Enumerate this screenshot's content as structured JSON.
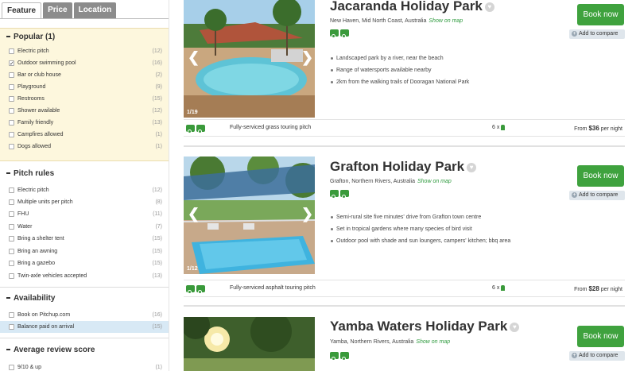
{
  "tabs": [
    "Feature",
    "Price",
    "Location"
  ],
  "sidebar": {
    "popular": {
      "title": "Popular (1)",
      "items": [
        {
          "label": "Electric pitch",
          "count": "(12)",
          "checked": false
        },
        {
          "label": "Outdoor swimming pool",
          "count": "(16)",
          "checked": true
        },
        {
          "label": "Bar or club house",
          "count": "(2)",
          "checked": false
        },
        {
          "label": "Playground",
          "count": "(9)",
          "checked": false
        },
        {
          "label": "Restrooms",
          "count": "(15)",
          "checked": false
        },
        {
          "label": "Shower available",
          "count": "(12)",
          "checked": false
        },
        {
          "label": "Family friendly",
          "count": "(13)",
          "checked": false
        },
        {
          "label": "Campfires allowed",
          "count": "(1)",
          "checked": false
        },
        {
          "label": "Dogs allowed",
          "count": "(1)",
          "checked": false
        }
      ]
    },
    "pitch_rules": {
      "title": "Pitch rules",
      "items": [
        {
          "label": "Electric pitch",
          "count": "(12)"
        },
        {
          "label": "Multiple units per pitch",
          "count": "(8)"
        },
        {
          "label": "FHU",
          "count": "(11)"
        },
        {
          "label": "Water",
          "count": "(7)"
        },
        {
          "label": "Bring a shelter tent",
          "count": "(15)"
        },
        {
          "label": "Bring an awning",
          "count": "(15)"
        },
        {
          "label": "Bring a gazebo",
          "count": "(15)"
        },
        {
          "label": "Twin-axle vehicles accepted",
          "count": "(13)"
        }
      ]
    },
    "availability": {
      "title": "Availability",
      "items": [
        {
          "label": "Book on Pitchup.com",
          "count": "(16)"
        },
        {
          "label": "Balance paid on arrival",
          "count": "(15)"
        }
      ]
    },
    "review": {
      "title": "Average review score",
      "items": [
        {
          "label": "9/10 & up",
          "count": "(1)"
        }
      ]
    }
  },
  "listings": [
    {
      "name": "Jacaranda Holiday Park",
      "location": "New Haven, Mid North Coast, Australia",
      "map_link": "Show on map",
      "photo_count": "1/19",
      "bullets": [
        "Landscaped park by a river, near the beach",
        "Range of watersports available nearby",
        "2km from the walking trails of Dooragan National Park"
      ],
      "book_label": "Book now",
      "compare_label": "Add to compare",
      "pitch_name": "Fully-serviced grass touring pitch",
      "occupancy": "6 x",
      "price_prefix": "From",
      "price": "$36",
      "price_suffix": "per night"
    },
    {
      "name": "Grafton Holiday Park",
      "location": "Grafton, Northern Rivers, Australia",
      "map_link": "Show on map",
      "photo_count": "1/12",
      "bullets": [
        "Semi-rural site five minutes' drive from Grafton town centre",
        "Set in tropical gardens where many species of bird visit",
        "Outdoor pool with shade and sun loungers, campers' kitchen; bbq area"
      ],
      "book_label": "Book now",
      "compare_label": "Add to compare",
      "pitch_name": "Fully-serviced asphalt touring pitch",
      "occupancy": "6 x",
      "price_prefix": "From",
      "price": "$28",
      "price_suffix": "per night"
    },
    {
      "name": "Yamba Waters Holiday Park",
      "location": "Yamba, Northern Rivers, Australia",
      "map_link": "Show on map",
      "book_label": "Book now",
      "compare_label": "Add to compare"
    }
  ],
  "colors": {
    "accent": "#3fa23e",
    "popular_bg": "#fdf7dd",
    "highlight_row": "#d8e9f5"
  }
}
